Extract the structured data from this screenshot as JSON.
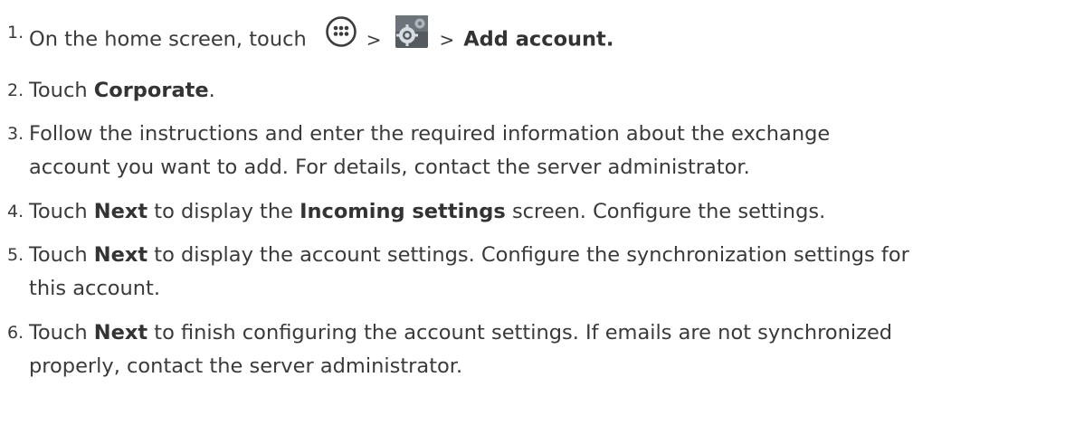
{
  "steps": [
    {
      "number": "1.",
      "a": "On the home screen, touch",
      "sep1": ">",
      "sep2": ">",
      "bold1": "Add account.",
      "icons": [
        "apps-icon",
        "settings-icon"
      ]
    },
    {
      "number": "2.",
      "a": "Touch ",
      "bold1": "Corporate",
      "b": "."
    },
    {
      "number": "3.",
      "line1": "Follow the instructions and enter the required information about the exchange",
      "line2": "account you want to add. For details, contact the server administrator."
    },
    {
      "number": "4.",
      "a": "Touch ",
      "bold1": "Next",
      "b": " to display the ",
      "bold2": "Incoming settings",
      "c": " screen. Configure the settings."
    },
    {
      "number": "5.",
      "a": "Touch ",
      "bold1": "Next",
      "b": " to display the account settings. Configure the synchronization settings for",
      "line2": "this account."
    },
    {
      "number": "6.",
      "a": "Touch ",
      "bold1": "Next",
      "b": " to finish configuring the account settings. If emails are not synchronized",
      "line2": "properly, contact the server administrator."
    }
  ]
}
